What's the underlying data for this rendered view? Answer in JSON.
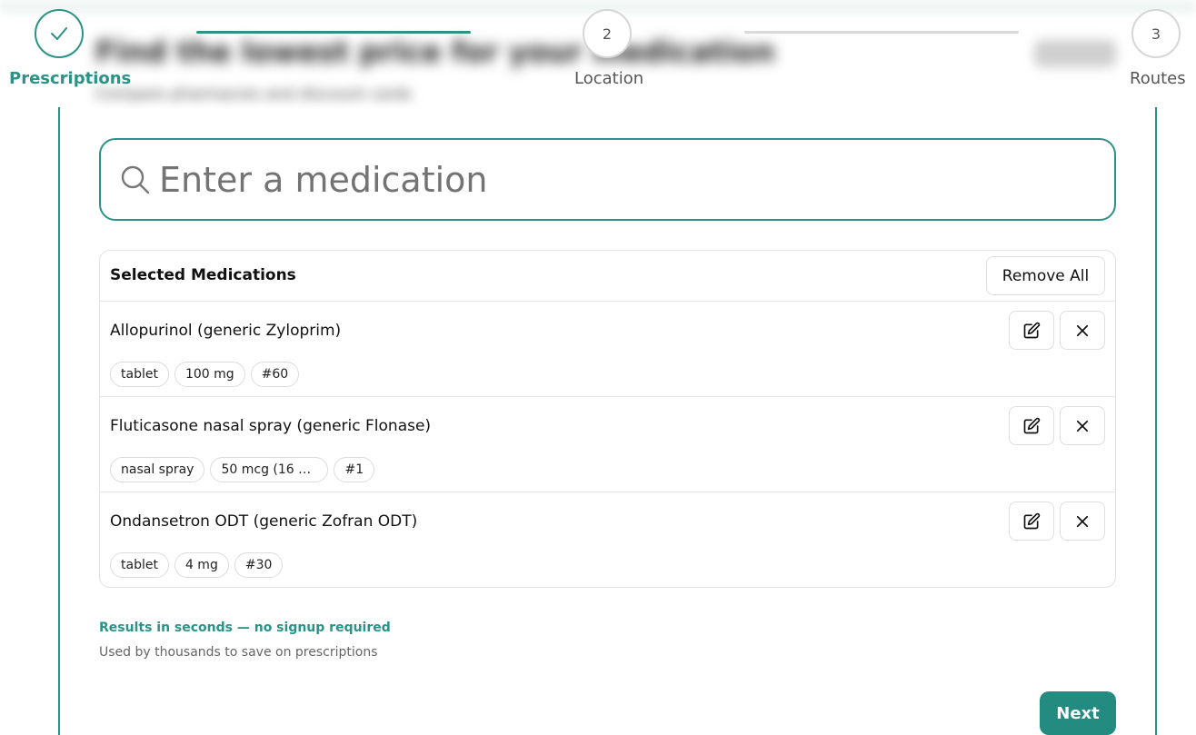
{
  "background": {
    "title": "Find the lowest price for your medication",
    "subtitle": "Compare pharmacies and discount cards"
  },
  "stepper": {
    "steps": [
      {
        "label": "Prescriptions",
        "number": "",
        "state": "completed",
        "icon": "check-icon"
      },
      {
        "label": "Location",
        "number": "2",
        "state": "pending"
      },
      {
        "label": "Routes",
        "number": "3",
        "state": "pending"
      }
    ]
  },
  "search": {
    "placeholder": "Enter a medication",
    "value": "",
    "icon": "search-icon"
  },
  "medications": {
    "title": "Selected Medications",
    "remove_all_label": "Remove All",
    "items": [
      {
        "name": "Allopurinol (generic Zyloprim)",
        "tags": [
          "tablet",
          "100 mg",
          "#60"
        ]
      },
      {
        "name": "Fluticasone nasal spray (generic Flonase)",
        "tags": [
          "nasal spray",
          "50 mcg (16 g...",
          "#1"
        ]
      },
      {
        "name": "Ondansetron ODT (generic Zofran ODT)",
        "tags": [
          "tablet",
          "4 mg",
          "#30"
        ]
      }
    ]
  },
  "footer": {
    "promo": "Results in seconds — no signup required",
    "promo_sub": "Used by thousands to save on prescriptions",
    "next_label": "Next"
  },
  "colors": {
    "accent": "#2a9287",
    "button": "#248b80",
    "pending": "#d9d9d9"
  }
}
